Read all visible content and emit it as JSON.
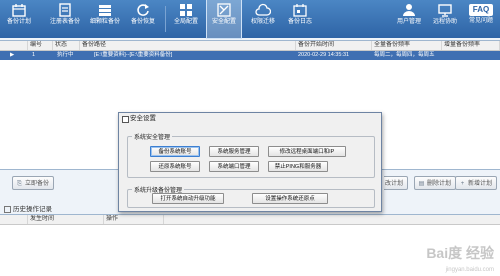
{
  "toolbar": {
    "items": [
      {
        "label": "备份计划",
        "icon": "calendar-icon"
      },
      {
        "label": "注册表备份",
        "icon": "registry-icon"
      },
      {
        "label": "细颗粒备份",
        "icon": "granular-backup-icon"
      },
      {
        "label": "备份恢复",
        "icon": "refresh-icon"
      },
      {
        "label": "全局配置",
        "icon": "grid-icon"
      },
      {
        "label": "安全配置",
        "icon": "security-icon"
      },
      {
        "label": "权限迁移",
        "icon": "cloud-icon"
      },
      {
        "label": "备份日志",
        "icon": "log-icon"
      }
    ],
    "right_items": [
      {
        "label": "用户管理",
        "icon": "user-icon"
      },
      {
        "label": "远程协助",
        "icon": "monitor-icon"
      },
      {
        "label": "常见问题",
        "icon": "faq-icon"
      }
    ],
    "faq_text": "FAQ"
  },
  "plan_table": {
    "columns": [
      "编号",
      "状态",
      "备份路径",
      "备份开始时间",
      "全量备份频率",
      "增量备份频率"
    ],
    "row": {
      "pointer": "▶",
      "id": "1",
      "status": "执行中",
      "path": "[E:\\重要资料]--[E:\\重要资料备份]",
      "start_time": "2020-02-29 14:35:31",
      "full_freq": "每周二，每周四，每周五",
      "incr_freq": ""
    }
  },
  "mid_toolbar": {
    "run_now": "立即备份",
    "delete_plan": "删除计划",
    "new_plan": "新增计划",
    "modify_plan": "改计划"
  },
  "history": {
    "label": "历史操作记录",
    "columns": [
      "发生时间",
      "操作"
    ]
  },
  "dialog": {
    "title": "安全设置",
    "group1": "系统安全管理",
    "buttons1": [
      "备份系统账号",
      "系统服务管理",
      "修改远程桌面端口和IP",
      "还原系统账号",
      "系统端口管理",
      "禁止PING和服务器"
    ],
    "group2": "系统升级备份管理",
    "buttons2": [
      "打开系统自动升级功能",
      "设置操作系统还原点"
    ]
  },
  "watermark": {
    "main": "Bai度 经验",
    "sub": "jingyan.baidu.com"
  }
}
